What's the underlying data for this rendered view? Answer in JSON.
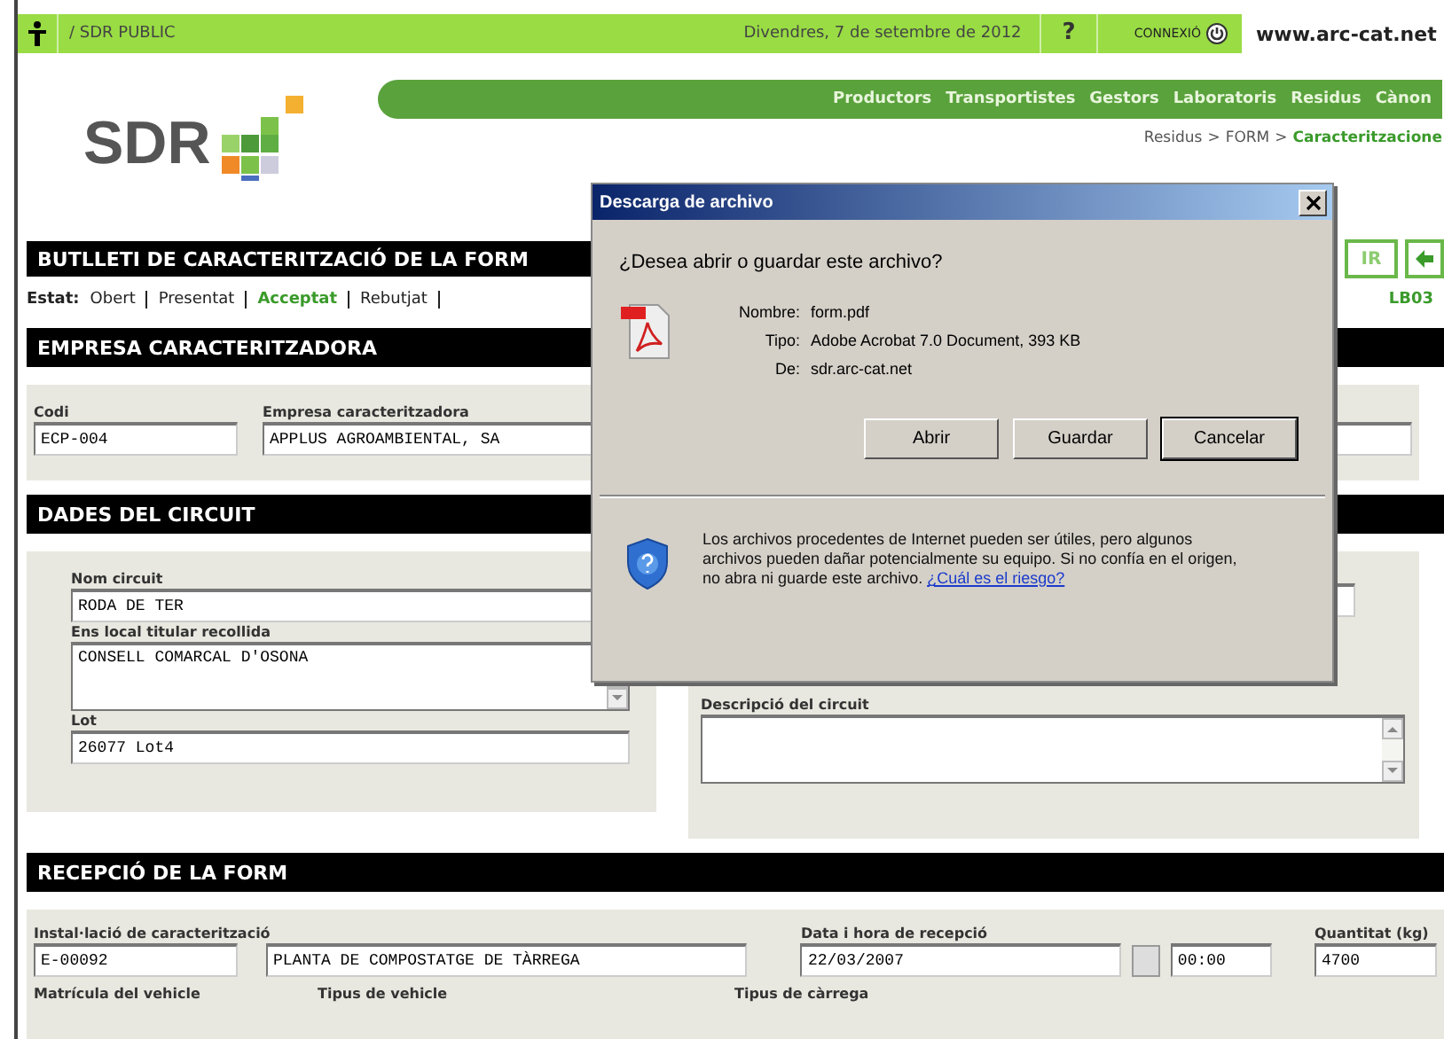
{
  "top_bar": {
    "site": "/ SDR PUBLIC",
    "date": "Divendres, 7 de setembre de 2012",
    "help": "?",
    "connect": "CONNEXIÓ",
    "url": "www.arc-cat.net"
  },
  "logo": {
    "text": "SDR"
  },
  "nav": [
    "Productors",
    "Transportistes",
    "Gestors",
    "Laboratoris",
    "Residus",
    "Cànon"
  ],
  "breadcrumb": [
    {
      "label": "Residus",
      "current": false
    },
    {
      "label": ">",
      "current": false
    },
    {
      "label": "FORM",
      "current": false
    },
    {
      "label": ">",
      "current": false
    },
    {
      "label": "Caracteritzacione",
      "current": true
    }
  ],
  "form": {
    "title": "BUTLLETI DE CARACTERITZACIÓ DE LA FORM",
    "title_buttons": [
      {
        "kind": "text",
        "label": "IR"
      },
      {
        "kind": "back"
      }
    ]
  },
  "status": {
    "label": "Estat:",
    "items": [
      {
        "label": "Obert",
        "selected": false
      },
      {
        "label": "Presentat",
        "selected": false
      },
      {
        "label": "Acceptat",
        "selected": true
      },
      {
        "label": "Rebutjat",
        "selected": false
      }
    ],
    "code": "LB03"
  },
  "sections": [
    {
      "title": "EMPRESA CARACTERITZADORA",
      "fields": [
        {
          "kind": "text",
          "label": "Codi",
          "value": "ECP-004"
        },
        {
          "kind": "text",
          "label": "Empresa caracteritzadora",
          "value": "APPLUS AGROAMBIENTAL, SA"
        },
        {
          "kind": "text"
        }
      ]
    },
    {
      "title": "DADES DEL CIRCUIT",
      "fields": [
        {
          "kind": "text",
          "label": "Nom circuit",
          "value": "RODA DE TER"
        },
        {
          "kind": "textarea",
          "label": "Ens local titular recollida",
          "value": "CONSELL COMARCAL D'OSONA"
        },
        {
          "kind": "text",
          "label": "Lot",
          "value": "26077 Lot4"
        },
        {
          "kind": "text"
        },
        {
          "kind": "textarea",
          "label": "Descripció del circuit"
        }
      ]
    },
    {
      "title": "RECEPCIÓ DE LA FORM",
      "fields": [
        {
          "kind": "text",
          "label": "Instal·lació de caracterització",
          "value": "E-00092"
        },
        {
          "kind": "text",
          "value": "PLANTA DE COMPOSTATGE DE TÀRREGA"
        },
        {
          "kind": "date",
          "label": "Data i hora de recepció",
          "value": "22/03/2007"
        },
        {
          "kind": "text",
          "value": "00:00"
        },
        {
          "kind": "text",
          "label": "Quantitat (kg)",
          "value": "4700"
        },
        {
          "kind": "label",
          "label": "Matrícula del vehicle"
        },
        {
          "kind": "label",
          "label": "Tipus de vehicle"
        },
        {
          "kind": "label",
          "label": "Tipus de càrrega"
        }
      ]
    }
  ],
  "dialog": {
    "title": "Descarga de archivo",
    "question": "¿Desea abrir o guardar este archivo?",
    "details": [
      {
        "label": "Nombre:",
        "value": "form.pdf"
      },
      {
        "label": "Tipo:",
        "value": "Adobe Acrobat 7.0 Document, 393 KB"
      },
      {
        "label": "De:",
        "value": "sdr.arc-cat.net"
      }
    ],
    "buttons": [
      {
        "label": "Abrir",
        "focused": false
      },
      {
        "label": "Guardar",
        "focused": false
      },
      {
        "label": "Cancelar",
        "focused": true
      }
    ],
    "warning": "Los archivos procedentes de Internet pueden ser útiles, pero algunos archivos pueden dañar potencialmente su equipo. Si no confía en el origen, no abra ni guarde este archivo.",
    "link": "¿Cuál es el riesgo?"
  }
}
